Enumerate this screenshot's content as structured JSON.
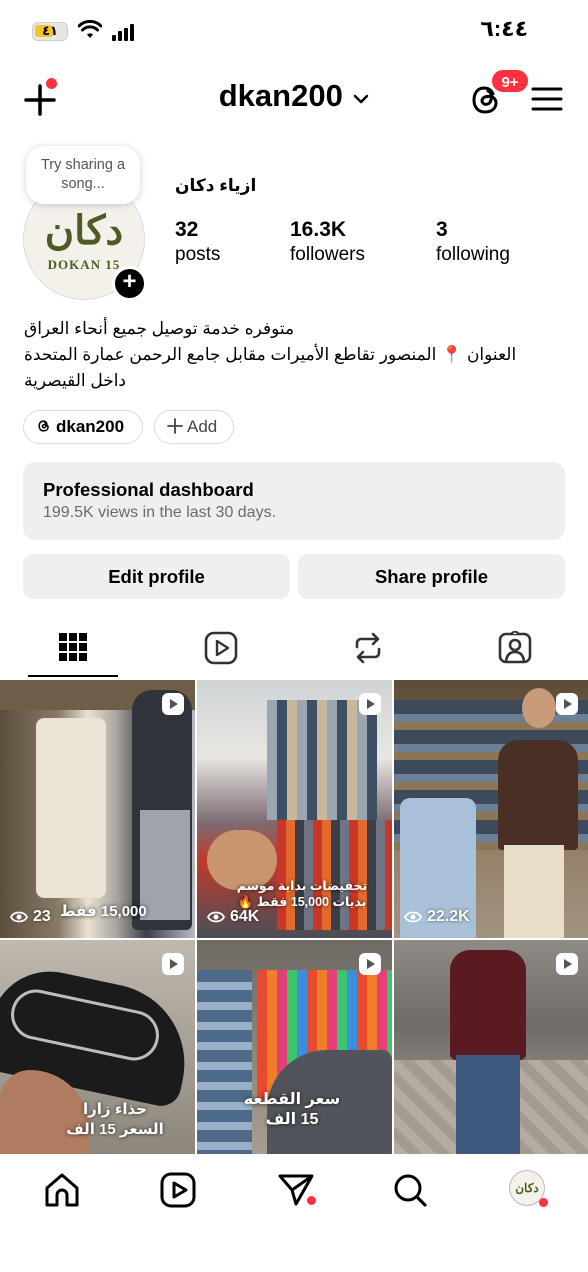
{
  "status_bar": {
    "battery": "٤١",
    "time": "٦:٤٤"
  },
  "nav": {
    "username": "dkan200",
    "notification_badge": "9+"
  },
  "profile": {
    "note": "Try sharing a song...",
    "avatar_logo": "دكان",
    "avatar_sub": "DOKAN 15",
    "display_name": "ازياء دكان",
    "stats": {
      "posts": {
        "value": "32",
        "label": "posts"
      },
      "followers": {
        "value": "16.3K",
        "label": "followers"
      },
      "following": {
        "value": "3",
        "label": "following"
      }
    },
    "bio": [
      "متوفره خدمة توصيل جميع أنحاء العراق",
      "العنوان 📍 المنصور تقاطع الأميرات مقابل جامع الرحمن عمارة المتحدة",
      "داخل القيصرية"
    ],
    "threads_chip": "dkan200",
    "add_chip": "Add"
  },
  "dashboard": {
    "title": "Professional dashboard",
    "subtitle": "199.5K views in the last 30 days."
  },
  "buttons": {
    "edit": "Edit profile",
    "share": "Share profile"
  },
  "posts": [
    {
      "views": "23",
      "overlay": "15,000 فقط"
    },
    {
      "views": "64K",
      "overlay": "تخفيضات بداية موسم\nبديات 15,000 فقط 🔥"
    },
    {
      "views": "22.2K",
      "overlay": ""
    },
    {
      "views": "",
      "overlay": "حذاء زارا\nالسعر 15 الف"
    },
    {
      "views": "",
      "overlay": "سعر القطعه\n15 الف"
    },
    {
      "views": "",
      "overlay": ""
    }
  ],
  "colors": {
    "accent_red": "#ff3040",
    "button_bg": "#efefef",
    "muted_text": "#6b6b6b"
  }
}
